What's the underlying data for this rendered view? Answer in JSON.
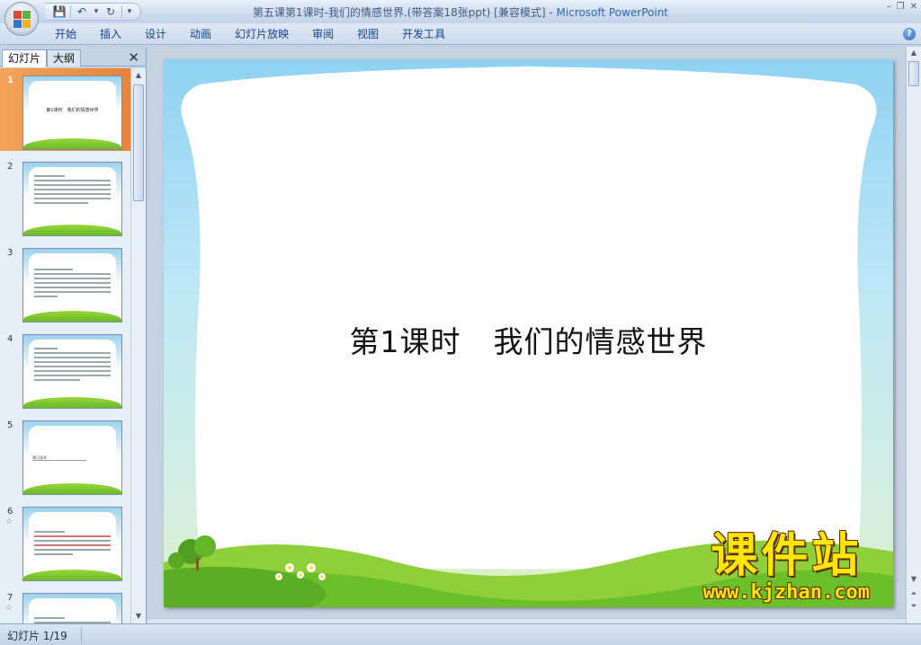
{
  "window": {
    "title": "第五课第1课时-我们的情感世界.(带答案18张ppt) [兼容模式] - ",
    "app_name": "Microsoft PowerPoint",
    "controls": [
      "–",
      "❐",
      "✕"
    ]
  },
  "quick_access": {
    "save": "💾",
    "undo": "↶",
    "undo_dropdown": "▾",
    "redo": "↻",
    "customize": "▾"
  },
  "ribbon": {
    "tabs": [
      "开始",
      "插入",
      "设计",
      "动画",
      "幻灯片放映",
      "审阅",
      "视图",
      "开发工具"
    ],
    "help": "?"
  },
  "left_pane": {
    "tab_slides": "幻灯片",
    "tab_outline": "大纲",
    "close": "✕",
    "thumbnails": [
      {
        "num": "1",
        "title": "第1课时　我们的情感世界",
        "selected": true,
        "star": ""
      },
      {
        "num": "2",
        "selected": false,
        "star": ""
      },
      {
        "num": "3",
        "selected": false,
        "star": ""
      },
      {
        "num": "4",
        "selected": false,
        "star": ""
      },
      {
        "num": "5",
        "label": "预习导学",
        "selected": false,
        "star": ""
      },
      {
        "num": "6",
        "selected": false,
        "star": "☆"
      },
      {
        "num": "7",
        "selected": false,
        "star": "☆"
      }
    ]
  },
  "slide": {
    "title_part1": "第1课时",
    "title_part2": "我们的情感世界"
  },
  "watermark": {
    "chinese": "课件站",
    "url": "www.kjzhan.com"
  },
  "status_bar": {
    "slide_indicator": "幻灯片 1/19"
  },
  "colors": {
    "office_logo": [
      "#e8452c",
      "#5fb13f",
      "#2f78c8",
      "#f0b419"
    ],
    "selected_thumb": "#f2a55b",
    "watermark": "#ffe600"
  }
}
